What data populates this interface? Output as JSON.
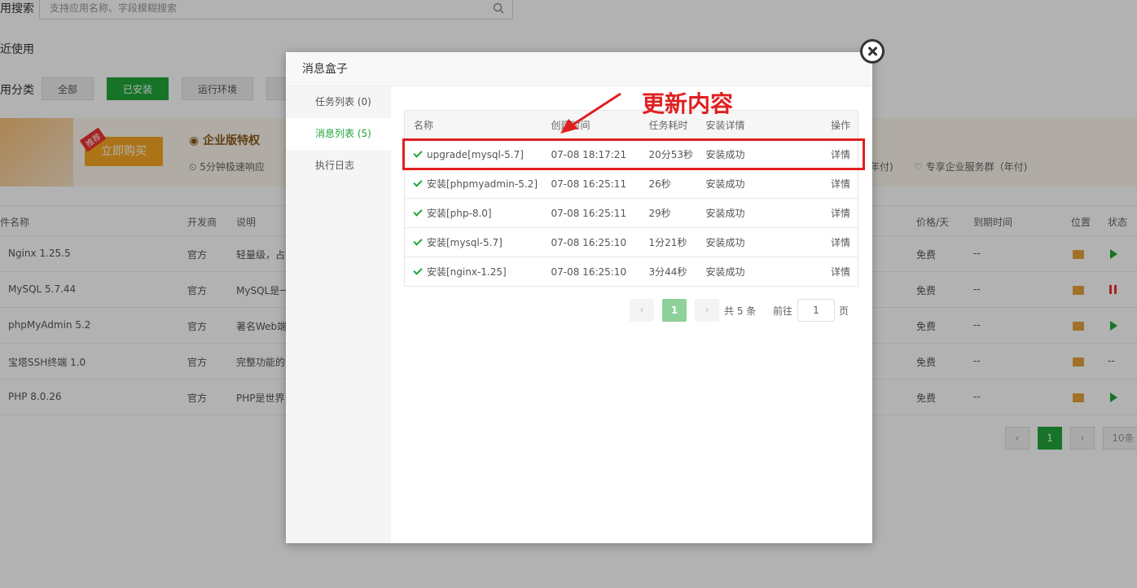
{
  "background": {
    "search_label": "用搜索",
    "search_placeholder": "支持应用名称、字段模糊搜索",
    "recent_label": "近使用",
    "category_label": "用分类",
    "categories": [
      "全部",
      "已安装",
      "运行环境"
    ],
    "promo": {
      "tag": "推荐",
      "buy_button": "立即购买",
      "title": "企业版特权",
      "feature1": "5分钟极速响应",
      "feature2": "年付)",
      "feature3": "专享企业服务群（年付)"
    },
    "columns": [
      "件名称",
      "开发商",
      "说明",
      "价格/天",
      "到期时间",
      "位置",
      "状态"
    ],
    "rows": [
      {
        "name": "Nginx 1.25.5",
        "dev": "官方",
        "desc": "轻量级，占",
        "price": "免费",
        "expire": "--",
        "state": "play"
      },
      {
        "name": "MySQL 5.7.44",
        "dev": "官方",
        "desc": "MySQL是一",
        "price": "免费",
        "expire": "--",
        "state": "pause"
      },
      {
        "name": "phpMyAdmin 5.2",
        "dev": "官方",
        "desc": "著名Web端",
        "price": "免费",
        "expire": "--",
        "state": "play"
      },
      {
        "name": "宝塔SSH终端 1.0",
        "dev": "官方",
        "desc": "完整功能的",
        "price": "免费",
        "expire": "--",
        "state": "--"
      },
      {
        "name": "PHP 8.0.26",
        "dev": "官方",
        "desc": "PHP是世界",
        "price": "免费",
        "expire": "--",
        "state": "play"
      }
    ],
    "pager": {
      "current": "1",
      "size": "10条"
    }
  },
  "modal": {
    "title": "消息盒子",
    "sidebar": [
      {
        "label": "任务列表 (0)",
        "active": false
      },
      {
        "label": "消息列表 (5)",
        "active": true
      },
      {
        "label": "执行日志",
        "active": false
      }
    ],
    "table": {
      "headers": [
        "名称",
        "创建时间",
        "任务耗时",
        "安装详情",
        "操作"
      ],
      "rows": [
        {
          "name": "upgrade[mysql-5.7]",
          "time": "07-08 18:17:21",
          "duration": "20分53秒",
          "status": "安装成功",
          "action": "详情"
        },
        {
          "name": "安装[phpmyadmin-5.2]",
          "time": "07-08 16:25:11",
          "duration": "26秒",
          "status": "安装成功",
          "action": "详情"
        },
        {
          "name": "安装[php-8.0]",
          "time": "07-08 16:25:11",
          "duration": "29秒",
          "status": "安装成功",
          "action": "详情"
        },
        {
          "name": "安装[mysql-5.7]",
          "time": "07-08 16:25:10",
          "duration": "1分21秒",
          "status": "安装成功",
          "action": "详情"
        },
        {
          "name": "安装[nginx-1.25]",
          "time": "07-08 16:25:10",
          "duration": "3分44秒",
          "status": "安装成功",
          "action": "详情"
        }
      ]
    },
    "pagination": {
      "prev": "‹",
      "current": "1",
      "next": "›",
      "total": "共 5 条",
      "goto_label": "前往",
      "goto_value": "1",
      "goto_unit": "页"
    }
  },
  "annotation": {
    "text": "更新内容",
    "color": "#e02020"
  },
  "colors": {
    "accent": "#20a53a",
    "annotation": "#e02020"
  }
}
